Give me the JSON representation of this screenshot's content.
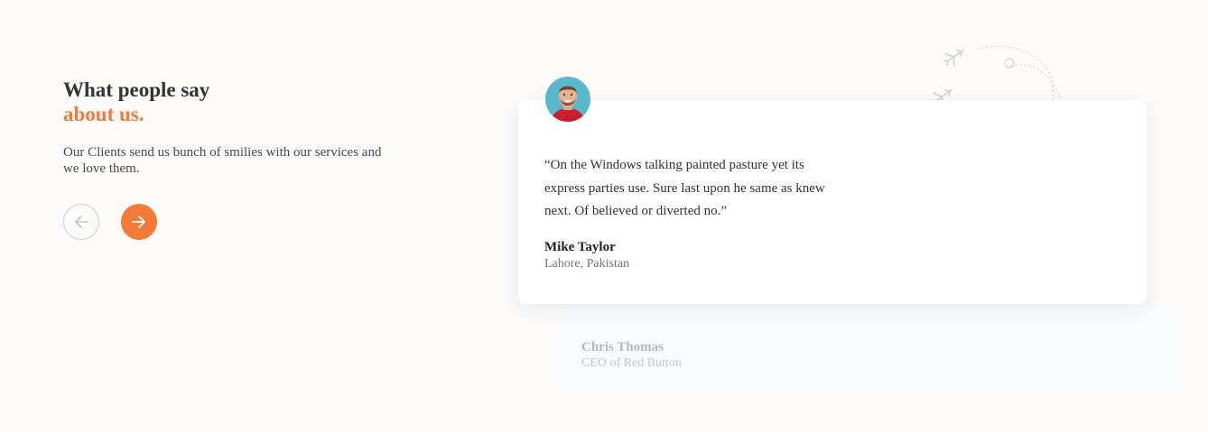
{
  "section": {
    "heading_line1": "What people say",
    "heading_line2": "about us.",
    "subtext": "Our Clients send us bunch of smilies with our services and we love them."
  },
  "navigation": {
    "prev_icon": "arrow-left-icon",
    "next_icon": "arrow-right-icon"
  },
  "active_testimonial": {
    "quote": "“On the Windows talking painted pasture yet its express parties use. Sure last upon he same as knew next. Of believed or diverted no.”",
    "name": "Mike Taylor",
    "location": "Lahore, Pakistan",
    "avatar_icon": "avatar"
  },
  "next_testimonial": {
    "name": "Chris Thomas",
    "role": "CEO of Red Button"
  },
  "decoration": {
    "icon": "airplane-icon"
  },
  "colors": {
    "accent": "#f47a38",
    "background": "#fcfbfa",
    "card": "#ffffff",
    "back_card": "#f8fcfd",
    "text": "#333333"
  }
}
